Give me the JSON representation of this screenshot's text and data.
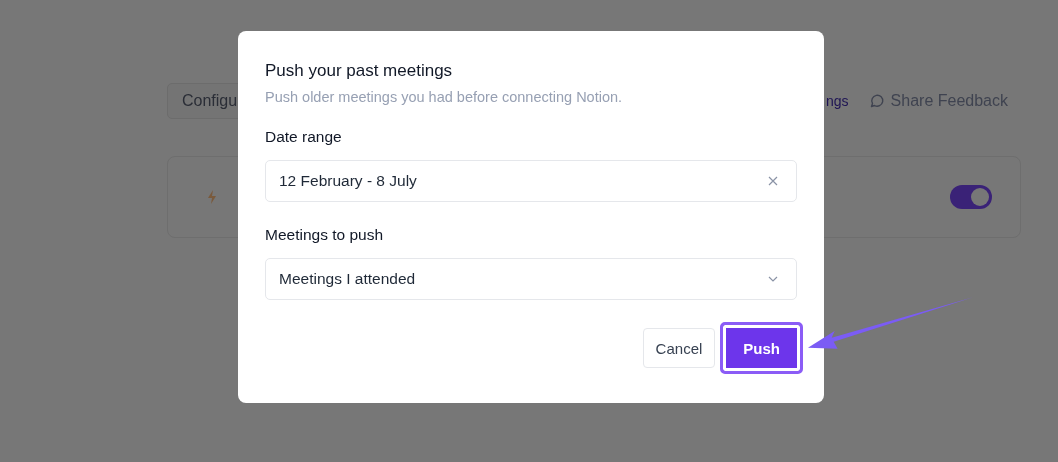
{
  "page": {
    "config_button": "Configu",
    "settings_link": "ngs",
    "feedback_link": "Share Feedback",
    "card": {
      "toggle_on": true
    }
  },
  "modal": {
    "title": "Push your past meetings",
    "subtitle": "Push older meetings you had before connecting Notion.",
    "fields": [
      {
        "kind": "text",
        "label": "Date range",
        "value": "12 February - 8 July"
      },
      {
        "kind": "select",
        "label": "Meetings to push",
        "value": "Meetings I attended"
      }
    ],
    "buttons": [
      {
        "kind": "secondary",
        "label": "Cancel",
        "highlighted": false
      },
      {
        "kind": "primary",
        "label": "Push",
        "highlighted": true
      }
    ]
  }
}
